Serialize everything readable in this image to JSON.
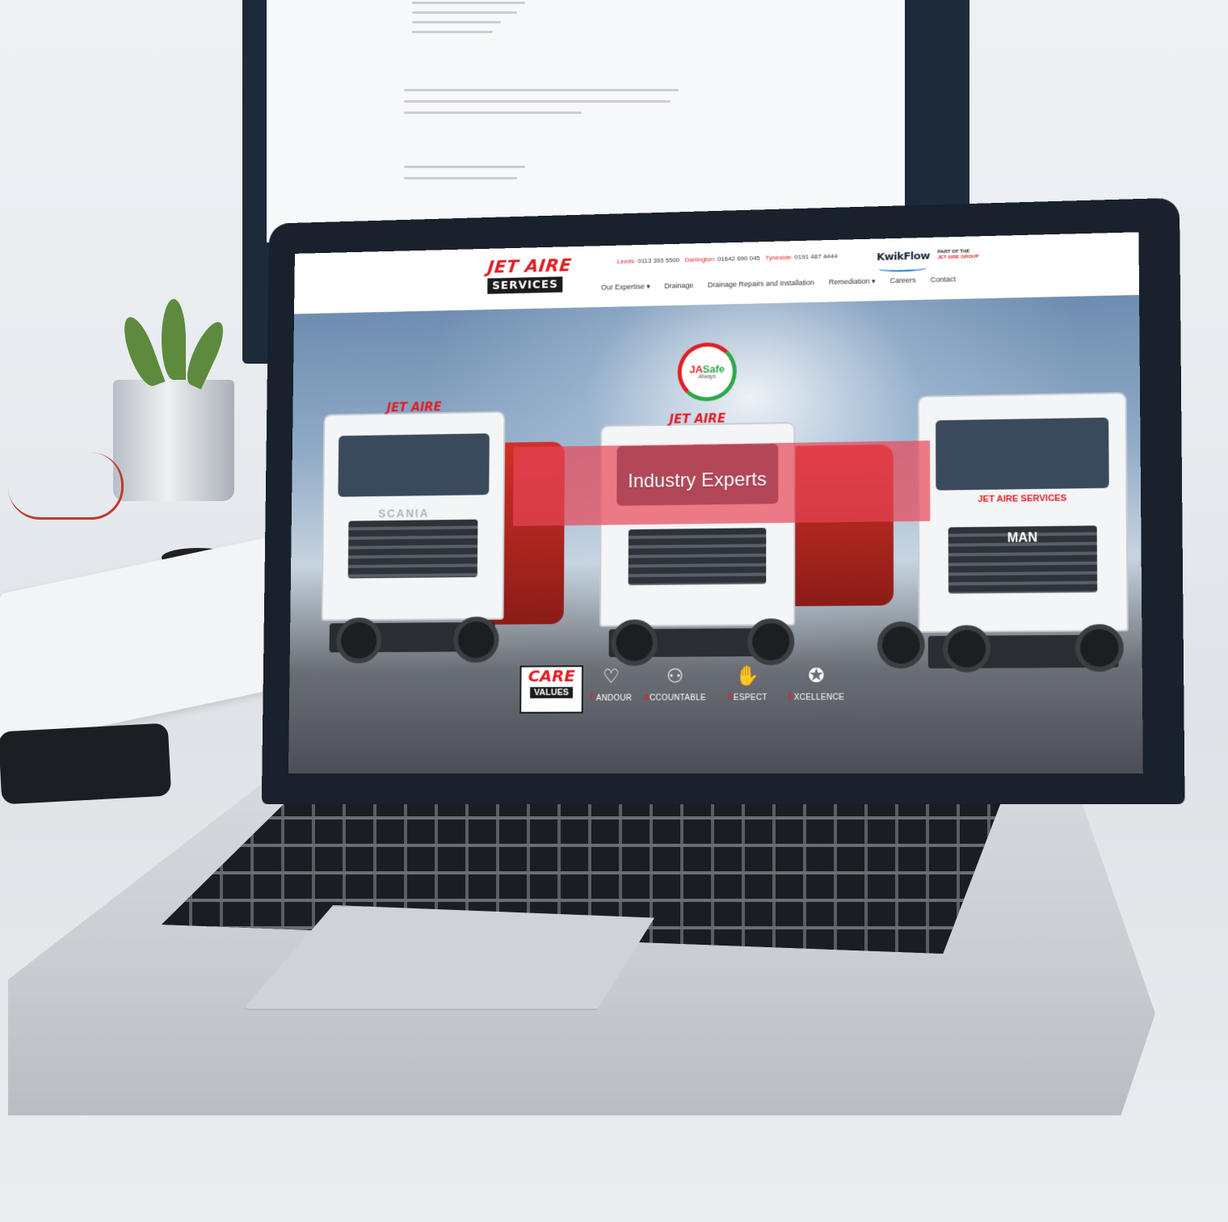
{
  "site": {
    "logo": {
      "line1": "JET AIRE",
      "line2": "SERVICES"
    },
    "phones": [
      {
        "location": "Leeds:",
        "number": "0113 393 5500"
      },
      {
        "location": "Darlington:",
        "number": "01642 690 045"
      },
      {
        "location": "Tyneside:",
        "number": "0191 487 4444"
      }
    ],
    "partner_logo": "KwikFlow",
    "part_of": {
      "line1": "PART OF THE",
      "line2": "JET AIRE GROUP"
    },
    "nav": [
      {
        "label": "Our Expertise",
        "has_dropdown": true
      },
      {
        "label": "Drainage",
        "has_dropdown": false
      },
      {
        "label": "Drainage Repairs and Installation",
        "has_dropdown": false
      },
      {
        "label": "Remediation",
        "has_dropdown": true
      },
      {
        "label": "Careers",
        "has_dropdown": false
      },
      {
        "label": "Contact",
        "has_dropdown": false
      }
    ],
    "hero": {
      "badge": {
        "ja": "JA",
        "safe": "Safe",
        "sub": "Always"
      },
      "headline": "Industry Experts",
      "truck_brands": [
        "JET AIRE",
        "JET AIRE",
        "JET AIRE SERVICES"
      ],
      "truck_makes": [
        "SCANIA",
        "MAN"
      ]
    },
    "care": {
      "title": "CARE",
      "subtitle": "VALUES",
      "values": [
        {
          "first": "C",
          "rest": "ANDOUR",
          "icon": "heart-handshake-icon"
        },
        {
          "first": "A",
          "rest": "CCOUNTABLE",
          "icon": "team-icon"
        },
        {
          "first": "R",
          "rest": "ESPECT",
          "icon": "high-five-icon"
        },
        {
          "first": "E",
          "rest": "XCELLENCE",
          "icon": "award-icon"
        }
      ]
    }
  },
  "colors": {
    "brand_red": "#e31d24",
    "brand_green": "#2fa84a",
    "dark": "#1b1b1b"
  }
}
